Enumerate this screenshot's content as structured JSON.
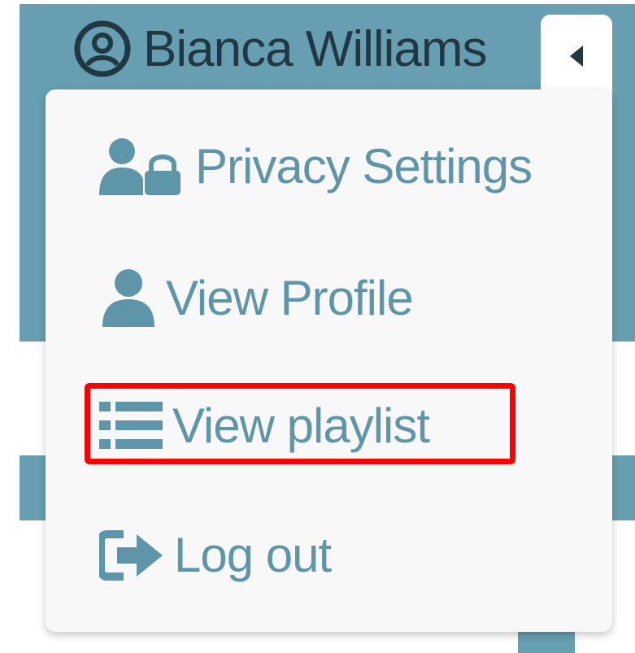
{
  "user": {
    "name": "Bianca Williams",
    "icon": "user-circle-icon"
  },
  "menu": {
    "items": [
      {
        "label": "Privacy Settings",
        "icon": "user-lock-icon"
      },
      {
        "label": "View Profile",
        "icon": "user-icon"
      },
      {
        "label": "View playlist",
        "icon": "list-icon",
        "highlighted": true
      },
      {
        "label": "Log out",
        "icon": "sign-out-icon"
      }
    ]
  },
  "colors": {
    "header_bg": "#679eb2",
    "menu_bg": "#f8f8f8",
    "menu_text": "#5f95a8",
    "header_text": "#213843",
    "highlight": "#ff0000"
  }
}
